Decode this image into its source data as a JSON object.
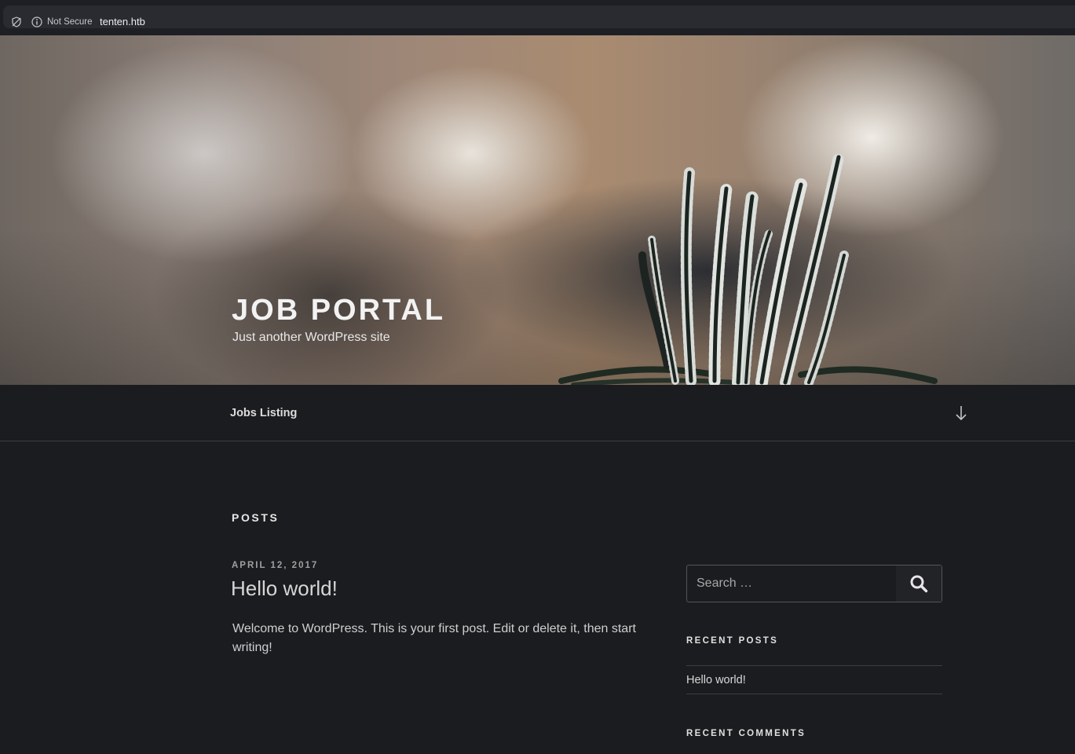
{
  "browser": {
    "security_label": "Not Secure",
    "url": "tenten.htb"
  },
  "header": {
    "site_title": "JOB PORTAL",
    "tagline": "Just another WordPress site"
  },
  "nav": {
    "items": [
      {
        "label": "Jobs Listing"
      }
    ]
  },
  "main": {
    "section_title": "POSTS",
    "posts": [
      {
        "date": "APRIL 12, 2017",
        "title": "Hello world!",
        "excerpt": "Welcome to WordPress. This is your first post. Edit or delete it, then start writing!"
      }
    ]
  },
  "sidebar": {
    "search": {
      "placeholder": "Search …"
    },
    "recent_posts": {
      "title": "RECENT POSTS",
      "items": [
        "Hello world!"
      ]
    },
    "recent_comments": {
      "title": "RECENT COMMENTS"
    }
  },
  "icons": {
    "tracking": "tracking-protection-icon",
    "info": "info-icon",
    "scroll": "arrow-down-icon",
    "search": "search-icon"
  },
  "colors": {
    "background": "#1b1c1f",
    "divider": "#3c3d40"
  }
}
